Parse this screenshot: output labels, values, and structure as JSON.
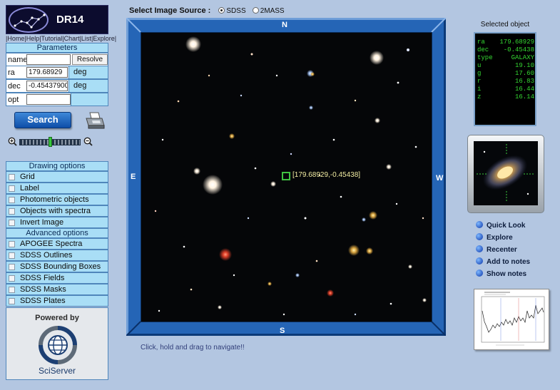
{
  "app": {
    "title": "DR14"
  },
  "nav_links": [
    "|Home",
    "|Help",
    "|Tutorial",
    "|Chart",
    "|List",
    "|Explore",
    "|"
  ],
  "parameters": {
    "heading": "Parameters",
    "name": {
      "label": "name",
      "value": "",
      "button": "Resolve"
    },
    "ra": {
      "label": "ra",
      "value": "179.68929",
      "unit": "deg"
    },
    "dec": {
      "label": "dec",
      "value": "-0.45437900",
      "unit": "deg"
    },
    "opt": {
      "label": "opt",
      "value": ""
    }
  },
  "search_button": "Search",
  "zoom": {
    "level_fraction": 0.5
  },
  "drawing_options": {
    "heading": "Drawing options",
    "items": [
      "Grid",
      "Label",
      "Photometric objects",
      "Objects with spectra",
      "Invert Image"
    ]
  },
  "advanced_options": {
    "heading": "Advanced options",
    "items": [
      "APOGEE Spectra",
      "SDSS Outlines",
      "SDSS Bounding Boxes",
      "SDSS Fields",
      "SDSS Masks",
      "SDSS Plates"
    ]
  },
  "powered_by": {
    "label": "Powered by",
    "brand": "SciServer"
  },
  "image_source": {
    "label": "Select Image Source :",
    "options": [
      {
        "label": "SDSS",
        "selected": true
      },
      {
        "label": "2MASS",
        "selected": false
      }
    ]
  },
  "compass": {
    "north": "N",
    "south": "S",
    "east": "E",
    "west": "W"
  },
  "marker_label": "[179.68929,-0.45438]",
  "drag_hint": "Click, hold and drag to navigate!!",
  "selected_object": {
    "heading": "Selected object",
    "rows": [
      {
        "key": "ra",
        "value": "179.68929"
      },
      {
        "key": "dec",
        "value": "-0.45438"
      },
      {
        "key": "type",
        "value": "GALAXY"
      },
      {
        "key": "u",
        "value": "19.10"
      },
      {
        "key": "g",
        "value": "17.60"
      },
      {
        "key": "r",
        "value": "16.83"
      },
      {
        "key": "i",
        "value": "16.44"
      },
      {
        "key": "z",
        "value": "16.14"
      }
    ]
  },
  "object_links": [
    "Quick Look",
    "Explore",
    "Recenter",
    "Add to notes",
    "Show notes"
  ],
  "colors": {
    "background": "#b3c6e1",
    "panel": "#a9def6",
    "frame": "#2565b6",
    "readout": "#35d832",
    "marker": "#40c040"
  }
}
